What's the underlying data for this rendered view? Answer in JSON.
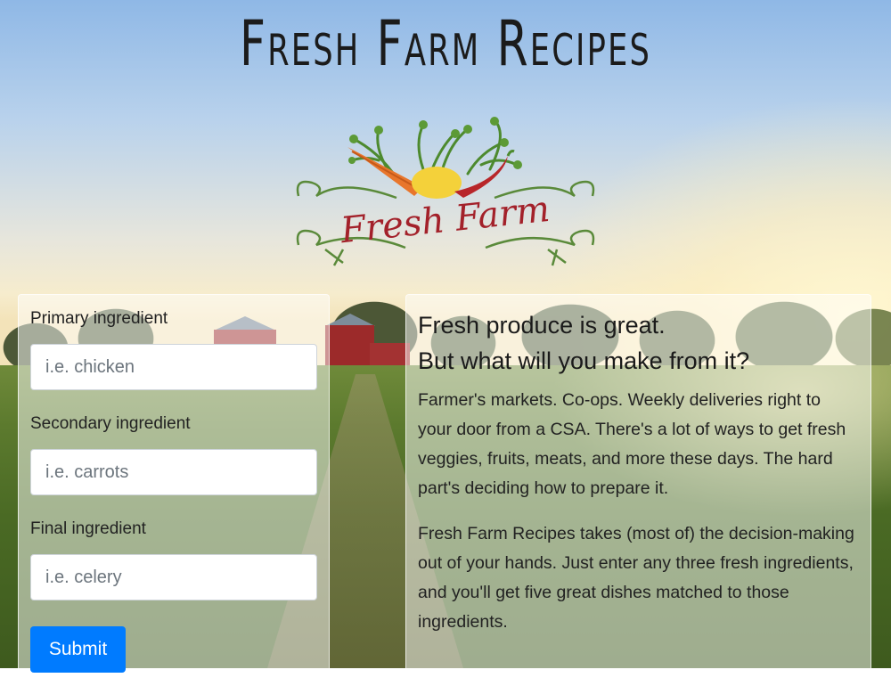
{
  "page_title": "Fresh Farm Recipes",
  "logo": {
    "text": "Fresh Farm"
  },
  "form": {
    "fields": [
      {
        "label": "Primary ingredient",
        "placeholder": "i.e. chicken"
      },
      {
        "label": "Secondary ingredient",
        "placeholder": "i.e. carrots"
      },
      {
        "label": "Final ingredient",
        "placeholder": "i.e. celery"
      }
    ],
    "submit_label": "Submit"
  },
  "info": {
    "heading_line1": "Fresh produce is great.",
    "heading_line2": "But what will you make from it?",
    "paragraph1": "Farmer's markets. Co-ops. Weekly deliveries right to your door from a CSA. There's a lot of ways to get fresh veggies, fruits, meats, and more these days. The hard part's deciding how to prepare it.",
    "paragraph2": "Fresh Farm Recipes takes (most of) the decision-making out of your hands. Just enter any three fresh ingredients, and you'll get five great dishes matched to those ingredients."
  },
  "colors": {
    "submit_bg": "#007bff",
    "logo_text": "#a3212a",
    "logo_flourish": "#5a8a3a",
    "carrot": "#e8762c",
    "pepper": "#b8262a",
    "lemon": "#f4d13a"
  }
}
